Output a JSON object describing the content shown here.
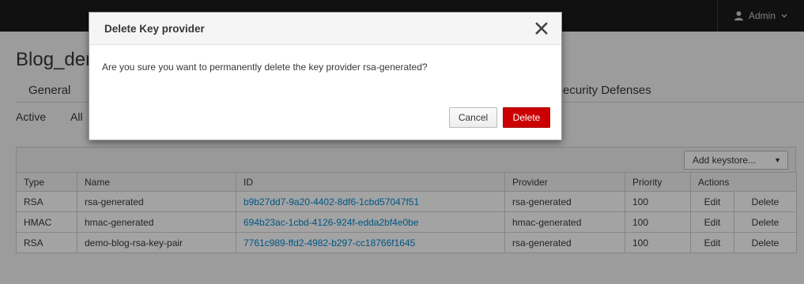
{
  "topbar": {
    "user_label": "Admin",
    "user_icon": "user-icon",
    "caret_icon": "chevron-down-icon"
  },
  "page": {
    "realm_title": "Blog_demo",
    "tabs": [
      "General",
      "Security Defenses"
    ],
    "subtabs": [
      "Active",
      "All"
    ]
  },
  "toolbar": {
    "add_keystore_label": "Add keystore...",
    "caret": "▼"
  },
  "table": {
    "headers": [
      "Type",
      "Name",
      "ID",
      "Provider",
      "Priority",
      "Actions"
    ],
    "rows": [
      {
        "type": "RSA",
        "name": "rsa-generated",
        "id": "b9b27dd7-9a20-4402-8df6-1cbd57047f51",
        "provider": "rsa-generated",
        "priority": "100",
        "edit": "Edit",
        "delete": "Delete"
      },
      {
        "type": "HMAC",
        "name": "hmac-generated",
        "id": "694b23ac-1cbd-4126-924f-edda2bf4e0be",
        "provider": "hmac-generated",
        "priority": "100",
        "edit": "Edit",
        "delete": "Delete"
      },
      {
        "type": "RSA",
        "name": "demo-blog-rsa-key-pair",
        "id": "7761c989-ffd2-4982-b297-cc18766f1645",
        "provider": "rsa-generated",
        "priority": "100",
        "edit": "Edit",
        "delete": "Delete"
      }
    ]
  },
  "modal": {
    "title": "Delete Key provider",
    "message": "Are you sure you want to permanently delete the key provider rsa-generated?",
    "cancel_label": "Cancel",
    "delete_label": "Delete",
    "close_icon": "close-icon",
    "delete_color": "#cc0000"
  }
}
